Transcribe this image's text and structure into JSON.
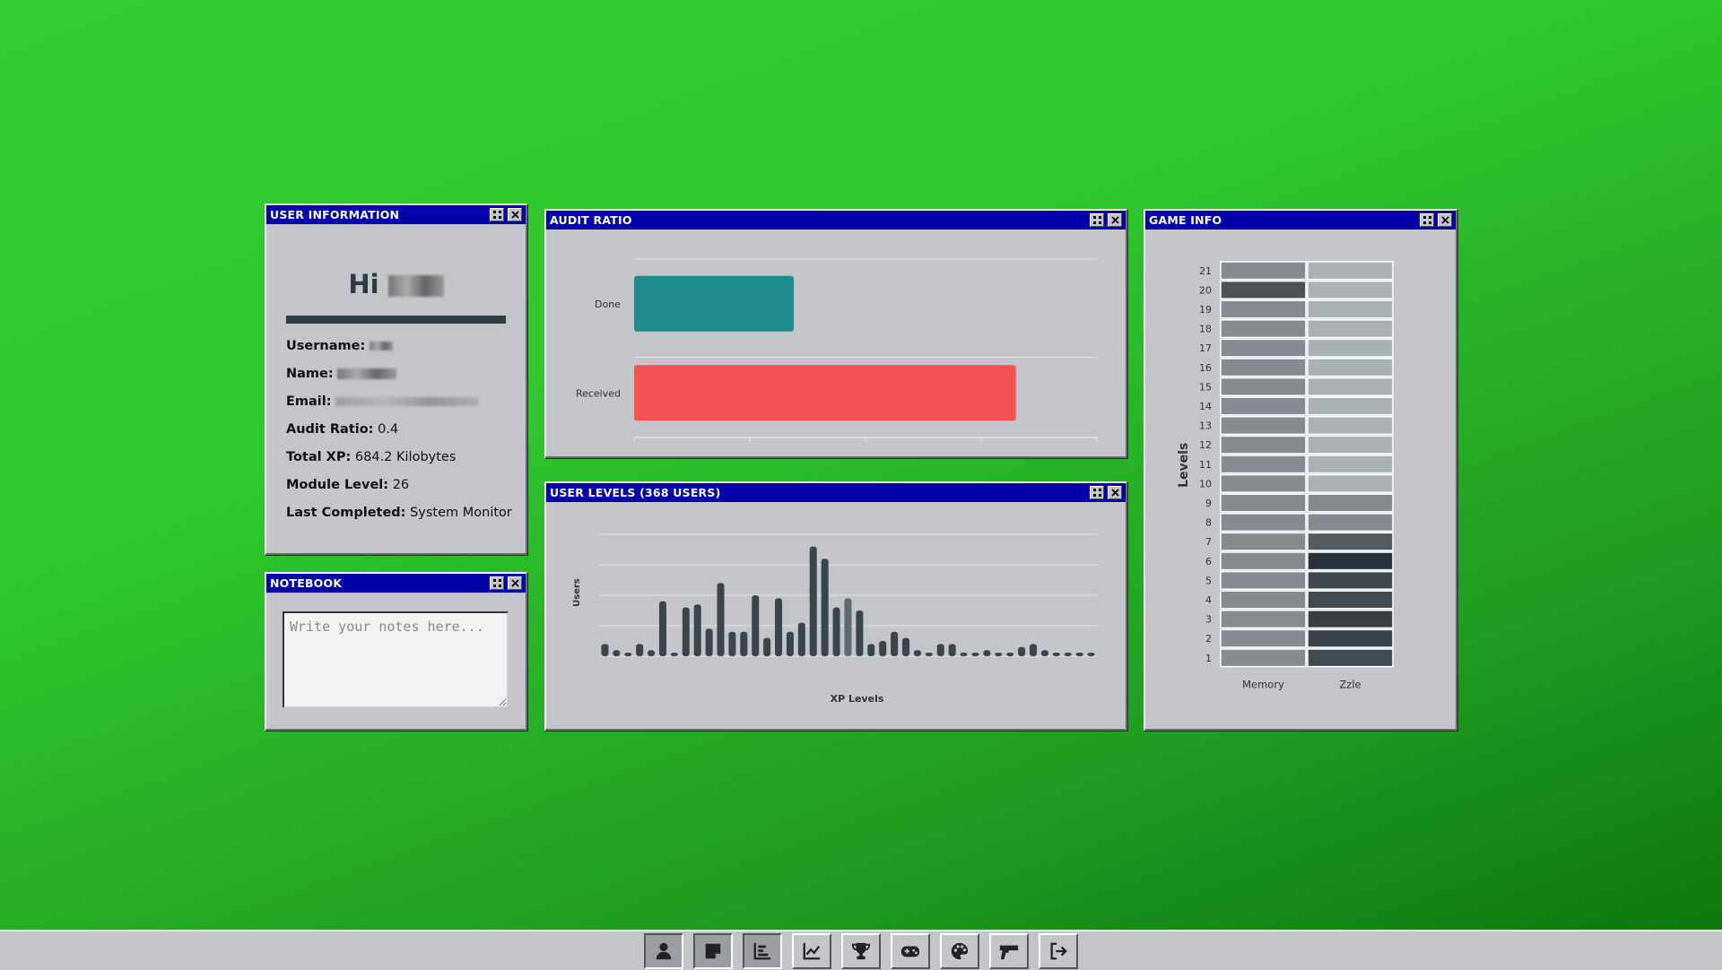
{
  "windows": {
    "user_info": {
      "title": "USER INFORMATION",
      "greeting": "Hi",
      "fields": [
        {
          "label": "Username:",
          "value": ""
        },
        {
          "label": "Name:",
          "value": ""
        },
        {
          "label": "Email:",
          "value": ""
        },
        {
          "label": "Audit Ratio:",
          "value": "0.4"
        },
        {
          "label": "Total XP:",
          "value": "684.2 Kilobytes"
        },
        {
          "label": "Module Level:",
          "value": "26"
        },
        {
          "label": "Last Completed:",
          "value": "System Monitor"
        }
      ]
    },
    "notebook": {
      "title": "NOTEBOOK",
      "placeholder": "Write your notes here...",
      "value": ""
    },
    "audit": {
      "title": "AUDIT RATIO"
    },
    "levels": {
      "title": "USER LEVELS (368 USERS)"
    },
    "game": {
      "title": "GAME INFO"
    }
  },
  "chart_data": [
    {
      "type": "bar",
      "orientation": "horizontal",
      "categories": [
        "Done",
        "Received"
      ],
      "values": [
        0.69,
        1.65
      ],
      "xlim": [
        0,
        2
      ],
      "colors": [
        "#1e8c8c",
        "#f55353"
      ],
      "grid": true
    },
    {
      "type": "bar",
      "xlabel": "XP Levels",
      "ylabel": "Users",
      "values": [
        4,
        2,
        1,
        4,
        2,
        18,
        1,
        16,
        17,
        9,
        24,
        8,
        8,
        20,
        6,
        19,
        8,
        11,
        36,
        32,
        16,
        19,
        15,
        4,
        5,
        8,
        6,
        2,
        1,
        4,
        4,
        1,
        1,
        2,
        1,
        1,
        3,
        4,
        2,
        1,
        1,
        1,
        1
      ],
      "highlight_index": 21,
      "ylim": [
        0,
        40
      ],
      "grid": true,
      "colors": {
        "bar": "#3b454c",
        "highlight": "#5e6a72"
      }
    },
    {
      "type": "heatmap",
      "ylabel": "Levels",
      "y": [
        "1",
        "2",
        "3",
        "4",
        "5",
        "6",
        "7",
        "8",
        "9",
        "10",
        "11",
        "12",
        "13",
        "14",
        "15",
        "16",
        "17",
        "18",
        "19",
        "20",
        "21"
      ],
      "columns": [
        "Memory",
        "Zzle"
      ],
      "cells": {
        "Memory": [
          "#858b90",
          "#858b90",
          "#858b90",
          "#858b90",
          "#858b90",
          "#858b90",
          "#858b90",
          "#858b90",
          "#858b90",
          "#858b90",
          "#858b90",
          "#858b90",
          "#858b90",
          "#858b90",
          "#858b90",
          "#858b90",
          "#858b90",
          "#858b90",
          "#858b90",
          "#4c5358",
          "#858b90"
        ],
        "Zzle": [
          "#434b52",
          "#3b4349",
          "#363e44",
          "#434b52",
          "#40484e",
          "#28313a",
          "#535b61",
          "#858b90",
          "#858b90",
          "#a9b1b3",
          "#a9b1b3",
          "#a9b1b3",
          "#a9b1b3",
          "#a9b1b3",
          "#a9b1b3",
          "#a9b1b3",
          "#a9b1b3",
          "#a9b1b3",
          "#a9b1b3",
          "#a9b1b3",
          "#a9b1b3"
        ]
      }
    }
  ],
  "taskbar": {
    "icons": [
      "user-icon",
      "sticky-note-icon",
      "bar-chart-icon",
      "line-chart-icon",
      "trophy-icon",
      "gamepad-icon",
      "palette-icon",
      "gun-icon",
      "logout-icon"
    ],
    "active": [
      0,
      1,
      2
    ]
  }
}
